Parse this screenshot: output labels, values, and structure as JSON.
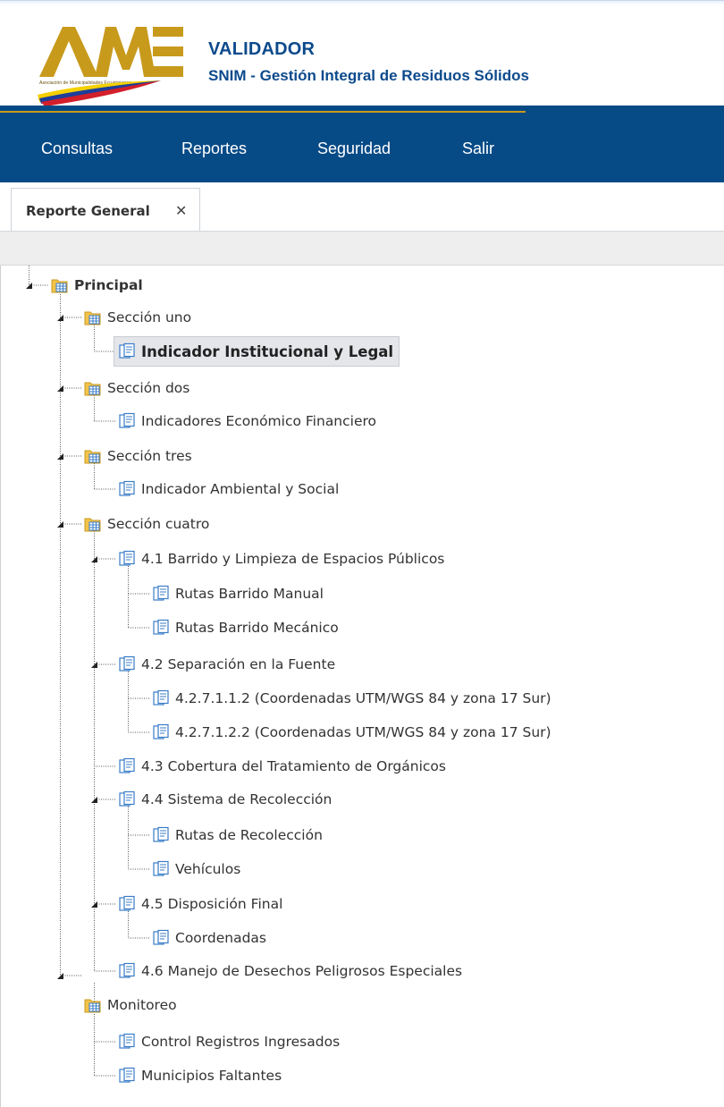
{
  "header": {
    "logo_text": "AME",
    "logo_subtext": "Asociación de Municipalidades Ecuatorianas",
    "title": "VALIDADOR",
    "subtitle": "SNIM - Gestión Integral de Residuos Sólidos"
  },
  "colors": {
    "brand_blue": "#064a86",
    "title_blue": "#0c4a8c",
    "logo_gold": "#c89a1c",
    "flag_yellow": "#f5d000",
    "flag_blue": "#1d3e9a",
    "flag_red": "#d21f2a"
  },
  "nav": {
    "items": [
      "Consultas",
      "Reportes",
      "Seguridad",
      "Salir"
    ]
  },
  "tabs": [
    {
      "label": "Reporte General",
      "close_icon": "close-icon"
    }
  ],
  "tree": {
    "root": "Principal",
    "nodes": [
      {
        "label": "Sección uno",
        "icon": "folder-icon"
      },
      {
        "label": "Indicador Institucional y Legal",
        "icon": "document-icon",
        "selected": true
      },
      {
        "label": "Sección dos",
        "icon": "folder-icon"
      },
      {
        "label": "Indicadores Económico Financiero",
        "icon": "document-icon"
      },
      {
        "label": "Sección tres",
        "icon": "folder-icon"
      },
      {
        "label": "Indicador Ambiental y Social",
        "icon": "document-icon"
      },
      {
        "label": "Sección cuatro",
        "icon": "folder-icon"
      },
      {
        "label": "4.1 Barrido y Limpieza de Espacios Públicos",
        "icon": "document-icon"
      },
      {
        "label": "Rutas Barrido Manual",
        "icon": "document-icon"
      },
      {
        "label": "Rutas Barrido Mecánico",
        "icon": "document-icon"
      },
      {
        "label": "4.2 Separación en la Fuente",
        "icon": "document-icon"
      },
      {
        "label": "4.2.7.1.1.2 (Coordenadas UTM/WGS 84 y zona 17 Sur)",
        "icon": "document-icon"
      },
      {
        "label": "4.2.7.1.2.2 (Coordenadas UTM/WGS 84 y zona 17 Sur)",
        "icon": "document-icon"
      },
      {
        "label": "4.3 Cobertura del Tratamiento de Orgánicos",
        "icon": "document-icon"
      },
      {
        "label": "4.4 Sistema de Recolección",
        "icon": "document-icon"
      },
      {
        "label": "Rutas de Recolección",
        "icon": "document-icon"
      },
      {
        "label": "Vehículos",
        "icon": "document-icon"
      },
      {
        "label": "4.5 Disposición Final",
        "icon": "document-icon"
      },
      {
        "label": "Coordenadas",
        "icon": "document-icon"
      },
      {
        "label": "4.6 Manejo de Desechos Peligrosos Especiales",
        "icon": "document-icon"
      },
      {
        "label": "Monitoreo",
        "icon": "folder-icon"
      },
      {
        "label": "Control Registros Ingresados",
        "icon": "document-icon"
      },
      {
        "label": "Municipios Faltantes",
        "icon": "document-icon"
      }
    ]
  }
}
